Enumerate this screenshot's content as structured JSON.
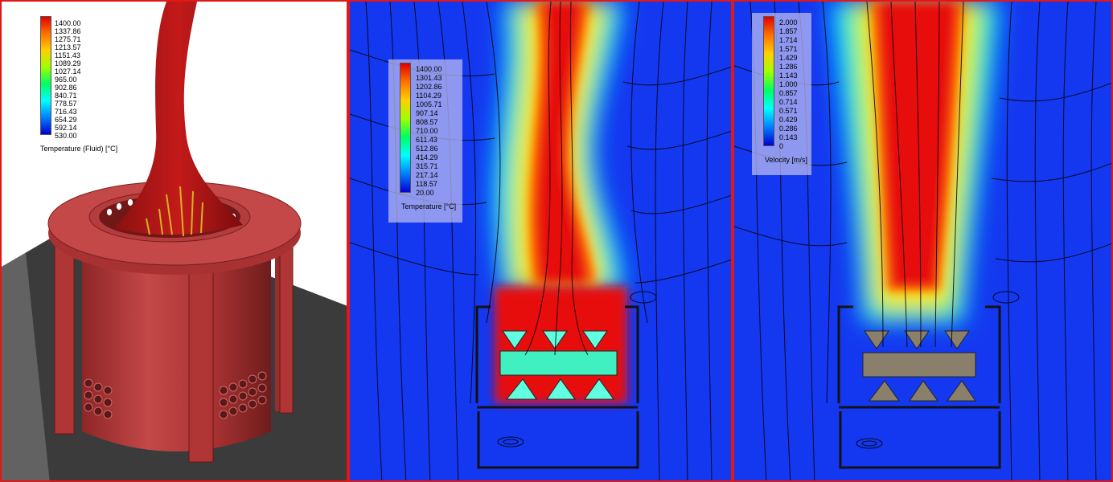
{
  "panels": {
    "solid": {
      "legend": {
        "title": "Temperature (Fluid) [°C]",
        "ticks": [
          "1400.00",
          "1337.86",
          "1275.71",
          "1213.57",
          "1151.43",
          "1089.29",
          "1027.14",
          "965.00",
          "902.86",
          "840.71",
          "778.57",
          "716.43",
          "654.29",
          "592.14",
          "530.00"
        ]
      }
    },
    "temperature": {
      "legend": {
        "title": "Temperature [°C]",
        "ticks": [
          "1400.00",
          "1301.43",
          "1202.86",
          "1104.29",
          "1005.71",
          "907.14",
          "808.57",
          "710.00",
          "611.43",
          "512.86",
          "414.29",
          "315.71",
          "217.14",
          "118.57",
          "20.00"
        ]
      }
    },
    "velocity": {
      "legend": {
        "title": "Velocity [m/s]",
        "ticks": [
          "2.000",
          "1.857",
          "1.714",
          "1.571",
          "1.429",
          "1.286",
          "1.143",
          "1.000",
          "0.857",
          "0.714",
          "0.571",
          "0.429",
          "0.286",
          "0.143",
          "0"
        ]
      }
    }
  },
  "colors": {
    "border": "#e01818",
    "field_low": "#1438f0",
    "field_high": "#e81010",
    "metal": "#b83a3a",
    "ground": "#3b3b3b",
    "solid_block": "#8a7f6a"
  }
}
